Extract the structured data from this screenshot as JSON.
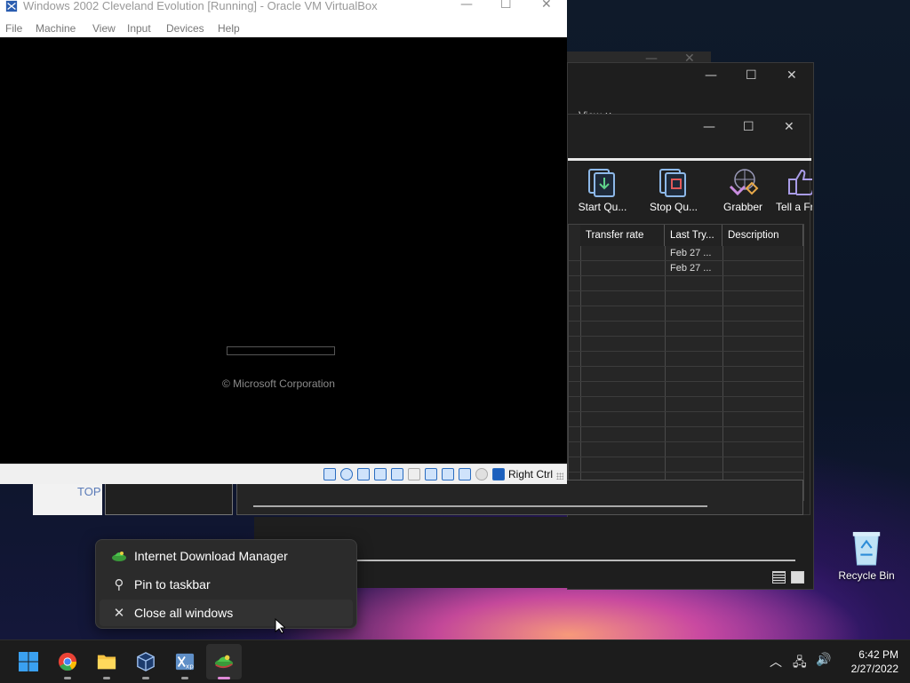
{
  "virtualbox": {
    "title": "Windows 2002 Cleveland Evolution [Running] - Oracle VM VirtualBox",
    "menu": [
      "File",
      "Machine",
      "View",
      "Input",
      "Devices",
      "Help"
    ],
    "boot_copyright": "© Microsoft Corporation",
    "host_key": "Right Ctrl"
  },
  "idm": {
    "menu_fragment": "View ∨",
    "menu_more": "…",
    "toolbar": [
      "Start Qu...",
      "Stop Qu...",
      "Grabber",
      "Tell a Fr"
    ],
    "columns": [
      "Transfer rate",
      "Last Try...",
      "Description"
    ],
    "rows": [
      {
        "transfer_rate": "",
        "last_try": "Feb 27 ...",
        "description": ""
      },
      {
        "transfer_rate": "",
        "last_try": "Feb 27 ...",
        "description": ""
      }
    ]
  },
  "background_window": {
    "fragment": "TOP"
  },
  "desktop": {
    "recycle_bin_label": "Recycle Bin"
  },
  "context_menu": {
    "items": [
      {
        "label": "Internet Download Manager",
        "icon": "idm-icon"
      },
      {
        "label": "Pin to taskbar",
        "icon": "pin-icon"
      },
      {
        "label": "Close all windows",
        "icon": "close-icon"
      }
    ]
  },
  "taskbar": {
    "apps": [
      "start-icon",
      "chrome-icon",
      "file-explorer-icon",
      "virtualbox-icon",
      "vmware-xp-icon",
      "idm-icon"
    ],
    "time": "6:42 PM",
    "date": "2/27/2022"
  },
  "colors": {
    "accent": "#2b8cd8",
    "taskbar": "#1c1c1c",
    "menu_bg": "#2b2b2b"
  }
}
